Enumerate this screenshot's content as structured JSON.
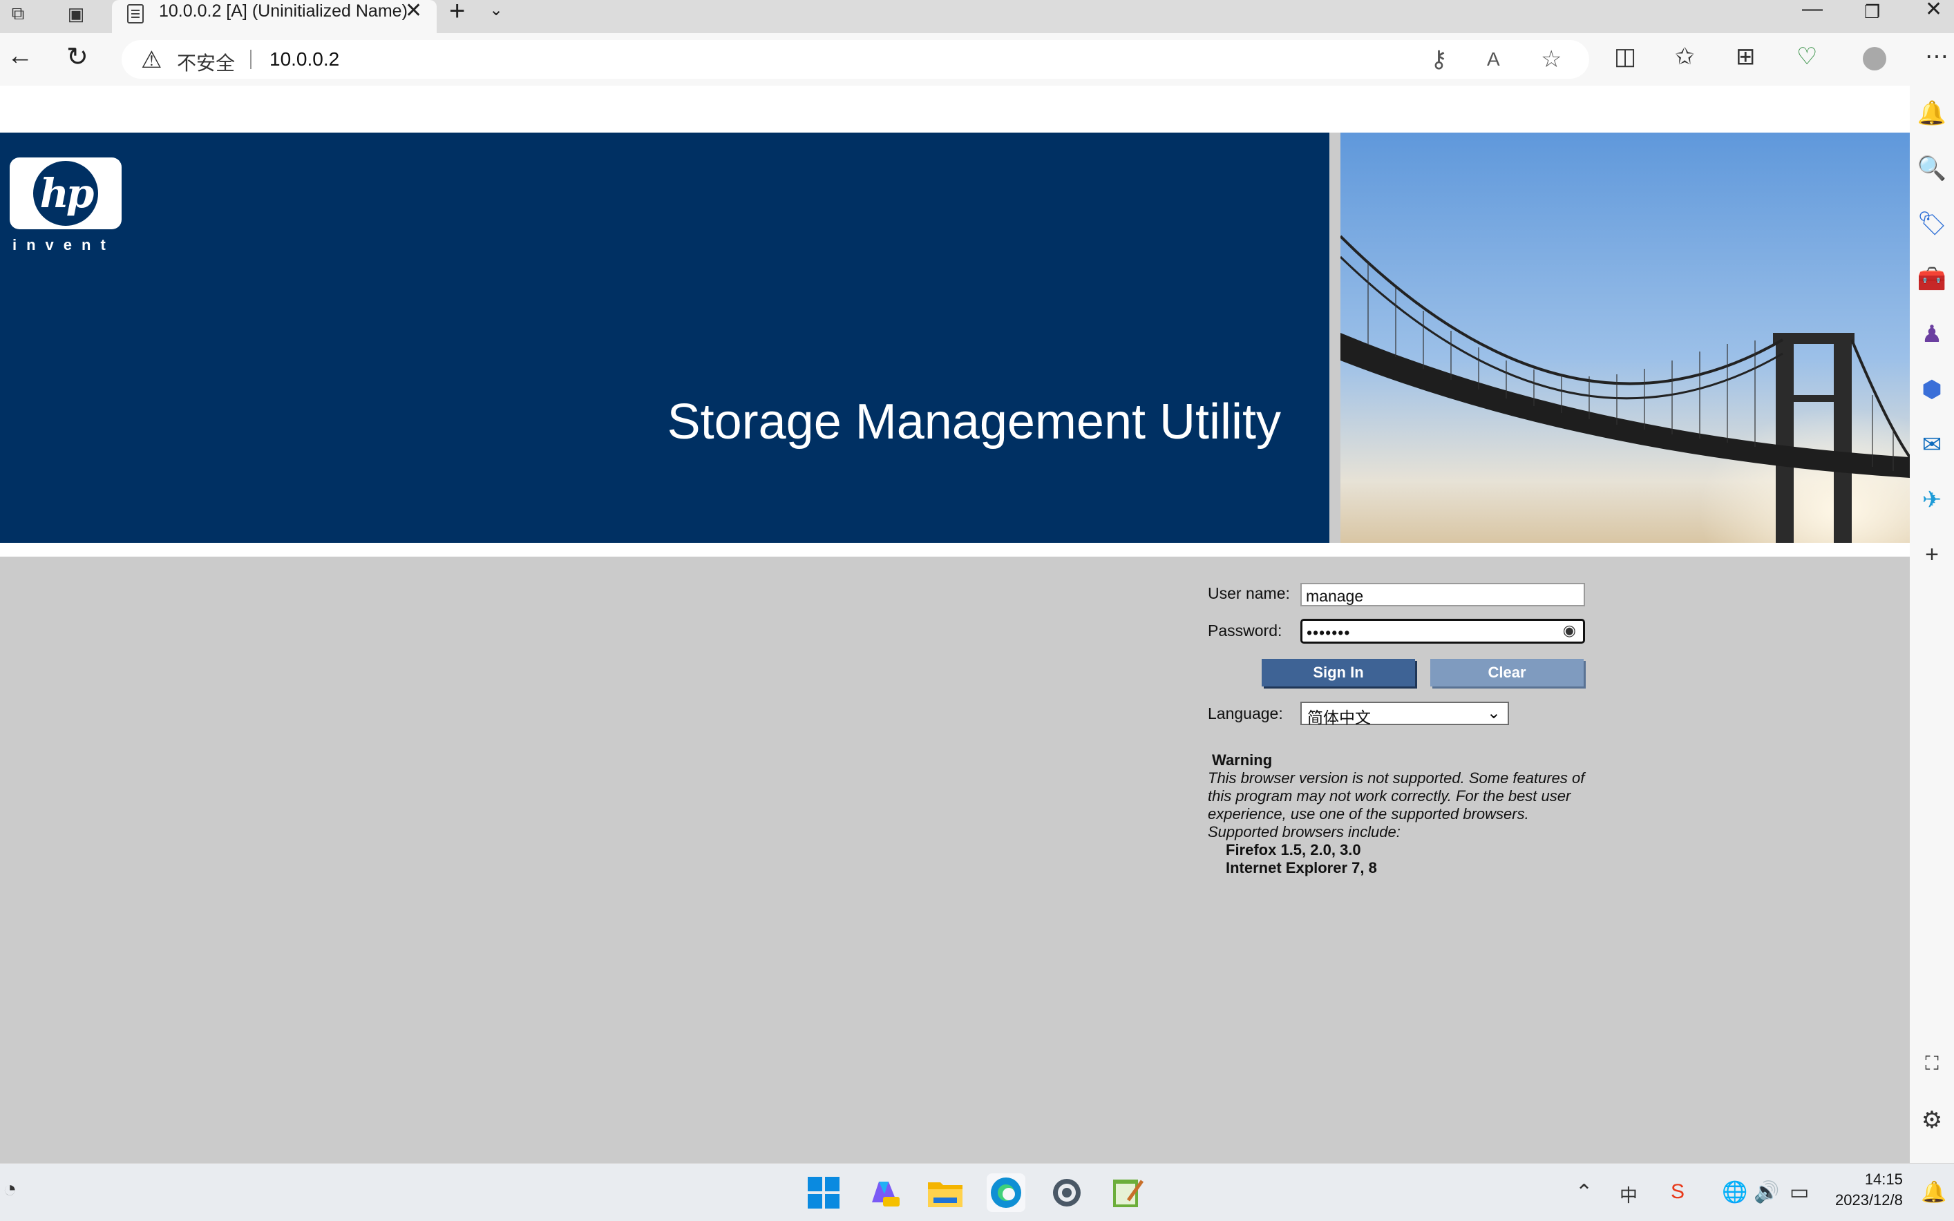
{
  "browser": {
    "tab": {
      "title": "10.0.0.2 [A] (Uninitialized Name)"
    },
    "address_bar": {
      "security_label": "不安全",
      "url": "10.0.0.2"
    }
  },
  "banner": {
    "logo_text": "hp",
    "logo_tagline": "invent",
    "title": "Storage Management Utility"
  },
  "login": {
    "username_label": "User name:",
    "username_value": "manage",
    "password_label": "Password:",
    "password_masked": "•••••••",
    "signin_label": "Sign In",
    "clear_label": "Clear",
    "language_label": "Language:",
    "language_value": "简体中文"
  },
  "warning": {
    "title": "Warning",
    "message": "This browser version is not supported. Some features of this program may not work correctly. For the best user experience, use one of the supported browsers. Supported browsers include:",
    "browsers": [
      "Firefox 1.5, 2.0, 3.0",
      "Internet Explorer 7, 8"
    ]
  },
  "taskbar": {
    "time": "14:15",
    "date": "2023/12/8",
    "ime": "中"
  },
  "icons": {
    "tab_actions": "tab-actions-icon",
    "vertical_tabs": "vertical-tabs-icon",
    "security_warning": "warning-icon"
  },
  "colors": {
    "banner_blue": "#003063",
    "page_gray": "#cbcbcb",
    "signin_button": "#3e6395",
    "clear_button": "#7f9bbf"
  }
}
